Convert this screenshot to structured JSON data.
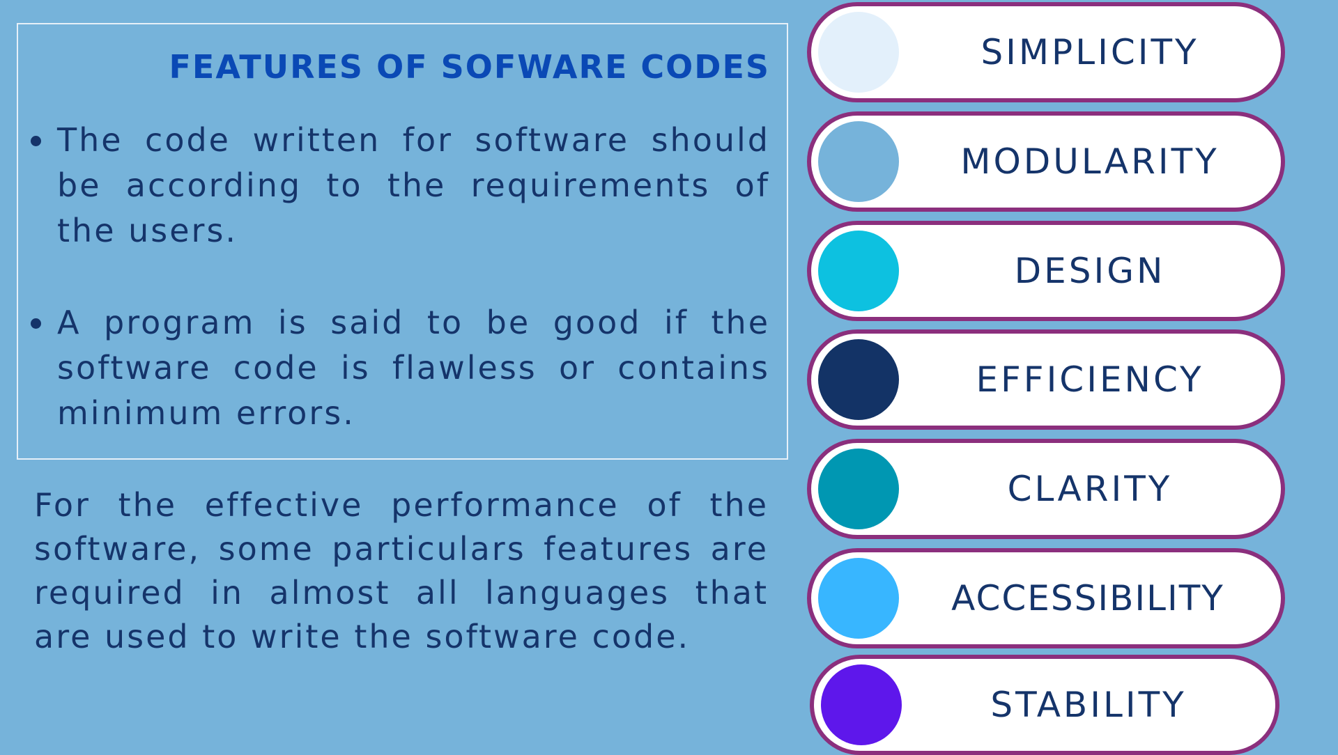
{
  "features_box": {
    "title": "FEATURES OF SOFWARE CODES",
    "bullets": [
      "The code written for software should be according to the requirements of the users.",
      "A program is said to be good if the software code is flawless or contains minimum errors."
    ]
  },
  "intro_paragraph": "For the effective performance of the software, some particulars features are required in almost all languages that are used to write the software code.",
  "features": [
    {
      "label": "SIMPLICITY",
      "circle_color": "#e3f0fb"
    },
    {
      "label": "MODULARITY",
      "circle_color": "#76b3da"
    },
    {
      "label": "DESIGN",
      "circle_color": "#0dc1e0"
    },
    {
      "label": "EFFICIENCY",
      "circle_color": "#133366"
    },
    {
      "label": "CLARITY",
      "circle_color": "#0097b2"
    },
    {
      "label": "ACCESSIBILITY",
      "circle_color": "#38b6ff"
    },
    {
      "label": "STABILITY",
      "circle_color": "#5e17eb"
    }
  ],
  "pill_border_color": "#8b2f7d"
}
